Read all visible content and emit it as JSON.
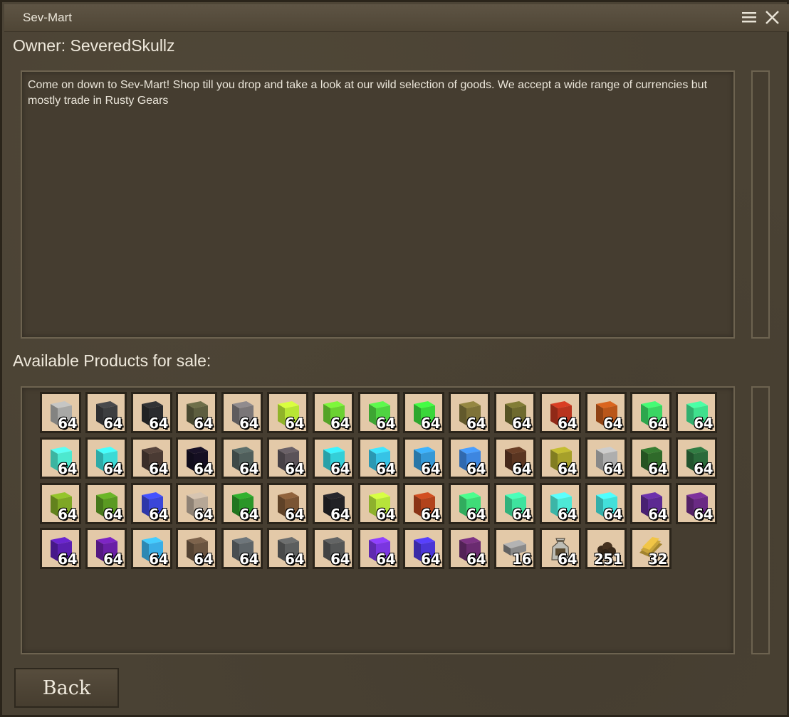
{
  "window": {
    "title": "Sev-Mart",
    "menu_icon": "hamburger-menu-icon",
    "close_icon": "close-icon"
  },
  "owner_label": "Owner: SeveredSkullz",
  "description": "Come on down to Sev-Mart! Shop till you drop and take a look at our wild selection of goods. We accept a wide range of currencies but mostly trade in Rusty Gears",
  "products_label": "Available Products for sale:",
  "back_label": "Back",
  "products": [
    {
      "qty": "64",
      "color": "#a8a8a6",
      "kind": "block"
    },
    {
      "qty": "64",
      "color": "#3d3e40",
      "kind": "block"
    },
    {
      "qty": "64",
      "color": "#2a2b2e",
      "kind": "block"
    },
    {
      "qty": "64",
      "color": "#5d5e3f",
      "kind": "block"
    },
    {
      "qty": "64",
      "color": "#7a7678",
      "kind": "block"
    },
    {
      "qty": "64",
      "color": "#b8e635",
      "kind": "block"
    },
    {
      "qty": "64",
      "color": "#6bd132",
      "kind": "block"
    },
    {
      "qty": "64",
      "color": "#4fd441",
      "kind": "block"
    },
    {
      "qty": "64",
      "color": "#3ad63a",
      "kind": "block"
    },
    {
      "qty": "64",
      "color": "#7e7238",
      "kind": "block"
    },
    {
      "qty": "64",
      "color": "#6e6a2e",
      "kind": "block"
    },
    {
      "qty": "64",
      "color": "#b8341e",
      "kind": "block"
    },
    {
      "qty": "64",
      "color": "#b9561a",
      "kind": "block"
    },
    {
      "qty": "64",
      "color": "#3ad563",
      "kind": "block"
    },
    {
      "qty": "64",
      "color": "#3fe08d",
      "kind": "block"
    },
    {
      "qty": "64",
      "color": "#4de8cf",
      "kind": "block"
    },
    {
      "qty": "64",
      "color": "#3bdad6",
      "kind": "block"
    },
    {
      "qty": "64",
      "color": "#4a3a33",
      "kind": "block"
    },
    {
      "qty": "64",
      "color": "#150f22",
      "kind": "block"
    },
    {
      "qty": "64",
      "color": "#4f5e5b",
      "kind": "block"
    },
    {
      "qty": "64",
      "color": "#5a5258",
      "kind": "block"
    },
    {
      "qty": "64",
      "color": "#33cfd8",
      "kind": "block"
    },
    {
      "qty": "64",
      "color": "#36c3e6",
      "kind": "block"
    },
    {
      "qty": "64",
      "color": "#3498d6",
      "kind": "block"
    },
    {
      "qty": "64",
      "color": "#3d86e0",
      "kind": "block"
    },
    {
      "qty": "64",
      "color": "#5a3521",
      "kind": "block"
    },
    {
      "qty": "64",
      "color": "#a6a02a",
      "kind": "block"
    },
    {
      "qty": "64",
      "color": "#aeaeae",
      "kind": "block"
    },
    {
      "qty": "64",
      "color": "#2f6a2a",
      "kind": "block"
    },
    {
      "qty": "64",
      "color": "#2a6a3a",
      "kind": "block"
    },
    {
      "qty": "64",
      "color": "#7ea725",
      "kind": "block"
    },
    {
      "qty": "64",
      "color": "#5a9a22",
      "kind": "block"
    },
    {
      "qty": "64",
      "color": "#3a46d9",
      "kind": "block"
    },
    {
      "qty": "64",
      "color": "#b6a796",
      "kind": "block"
    },
    {
      "qty": "64",
      "color": "#2a9628",
      "kind": "block"
    },
    {
      "qty": "64",
      "color": "#7a5433",
      "kind": "block"
    },
    {
      "qty": "64",
      "color": "#222226",
      "kind": "block"
    },
    {
      "qty": "64",
      "color": "#b6e33a",
      "kind": "block"
    },
    {
      "qty": "64",
      "color": "#b2431c",
      "kind": "block"
    },
    {
      "qty": "64",
      "color": "#3fdc78",
      "kind": "block"
    },
    {
      "qty": "64",
      "color": "#3ee39e",
      "kind": "block"
    },
    {
      "qty": "64",
      "color": "#4de8d6",
      "kind": "block"
    },
    {
      "qty": "64",
      "color": "#42e0da",
      "kind": "block"
    },
    {
      "qty": "64",
      "color": "#5c2a92",
      "kind": "block"
    },
    {
      "qty": "64",
      "color": "#6a2a84",
      "kind": "block"
    },
    {
      "qty": "64",
      "color": "#5a1fb0",
      "kind": "block"
    },
    {
      "qty": "64",
      "color": "#6a1fa6",
      "kind": "block"
    },
    {
      "qty": "64",
      "color": "#3aaee6",
      "kind": "block"
    },
    {
      "qty": "64",
      "color": "#6a5440",
      "kind": "block"
    },
    {
      "qty": "64",
      "color": "#5d6468",
      "kind": "block"
    },
    {
      "qty": "64",
      "color": "#5c5e5e",
      "kind": "block"
    },
    {
      "qty": "64",
      "color": "#545656",
      "kind": "block"
    },
    {
      "qty": "64",
      "color": "#7a36e0",
      "kind": "block"
    },
    {
      "qty": "64",
      "color": "#4a36d6",
      "kind": "block"
    },
    {
      "qty": "64",
      "color": "#6a2b70",
      "kind": "block"
    },
    {
      "qty": "16",
      "color": "#8a8a8a",
      "kind": "ingot"
    },
    {
      "qty": "64",
      "color": "#bdbdb5",
      "kind": "bag"
    },
    {
      "qty": "251",
      "color": "#3a2a1a",
      "kind": "pile"
    },
    {
      "qty": "32",
      "color": "#c9a43a",
      "kind": "sheets"
    }
  ]
}
